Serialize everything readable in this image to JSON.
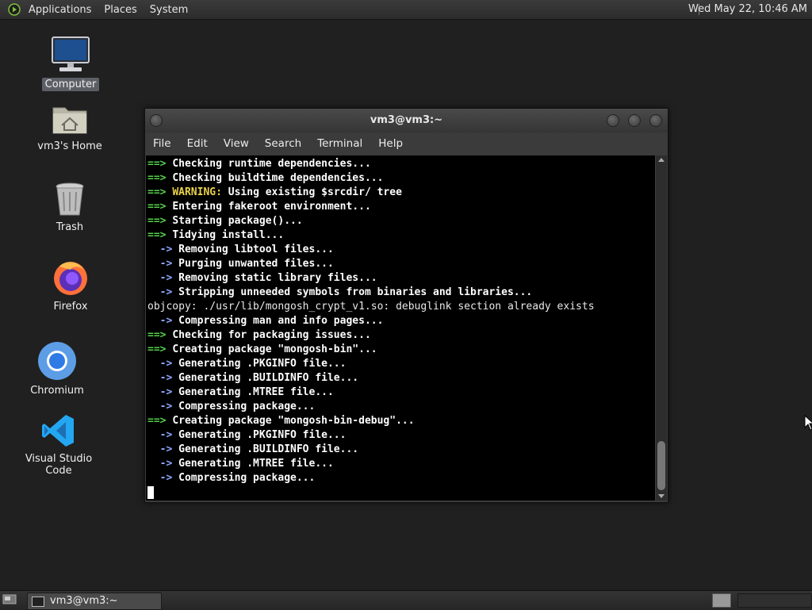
{
  "top_panel": {
    "menus": [
      "Applications",
      "Places",
      "System"
    ],
    "clock": "Wed May 22, 10:46 AM"
  },
  "desktop": {
    "icons": [
      {
        "label": "Computer",
        "icon": "computer-icon",
        "selected": true
      },
      {
        "label": "vm3's Home",
        "icon": "home-folder-icon",
        "selected": false
      },
      {
        "label": "Trash",
        "icon": "trash-icon",
        "selected": false
      },
      {
        "label": "Firefox",
        "icon": "firefox-icon",
        "selected": false
      },
      {
        "label": "Chromium",
        "icon": "chromium-icon",
        "selected": false
      },
      {
        "label": "Visual Studio Code",
        "icon": "vscode-icon",
        "selected": false
      }
    ]
  },
  "terminal": {
    "title": "vm3@vm3:~",
    "menu": [
      "File",
      "Edit",
      "View",
      "Search",
      "Terminal",
      "Help"
    ],
    "lines": [
      {
        "prefix": "==> ",
        "style": "arrow",
        "text": "Checking runtime dependencies..."
      },
      {
        "prefix": "==> ",
        "style": "arrow",
        "text": "Checking buildtime dependencies..."
      },
      {
        "prefix": "==> ",
        "style": "arrow",
        "warn": "WARNING:",
        "text": " Using existing $srcdir/ tree"
      },
      {
        "prefix": "==> ",
        "style": "arrow",
        "text": "Entering fakeroot environment..."
      },
      {
        "prefix": "==> ",
        "style": "arrow",
        "text": "Starting package()..."
      },
      {
        "prefix": "==> ",
        "style": "arrow",
        "text": "Tidying install..."
      },
      {
        "prefix": "  -> ",
        "style": "sub",
        "text": "Removing libtool files..."
      },
      {
        "prefix": "  -> ",
        "style": "sub",
        "text": "Purging unwanted files..."
      },
      {
        "prefix": "  -> ",
        "style": "sub",
        "text": "Removing static library files..."
      },
      {
        "prefix": "  -> ",
        "style": "sub",
        "text": "Stripping unneeded symbols from binaries and libraries..."
      },
      {
        "prefix": "",
        "style": "plain",
        "text": "objcopy: ./usr/lib/mongosh_crypt_v1.so: debuglink section already exists"
      },
      {
        "prefix": "  -> ",
        "style": "sub",
        "text": "Compressing man and info pages..."
      },
      {
        "prefix": "==> ",
        "style": "arrow",
        "text": "Checking for packaging issues..."
      },
      {
        "prefix": "==> ",
        "style": "arrow",
        "text": "Creating package \"mongosh-bin\"..."
      },
      {
        "prefix": "  -> ",
        "style": "sub",
        "text": "Generating .PKGINFO file..."
      },
      {
        "prefix": "  -> ",
        "style": "sub",
        "text": "Generating .BUILDINFO file..."
      },
      {
        "prefix": "  -> ",
        "style": "sub",
        "text": "Generating .MTREE file..."
      },
      {
        "prefix": "  -> ",
        "style": "sub",
        "text": "Compressing package..."
      },
      {
        "prefix": "==> ",
        "style": "arrow",
        "text": "Creating package \"mongosh-bin-debug\"..."
      },
      {
        "prefix": "  -> ",
        "style": "sub",
        "text": "Generating .PKGINFO file..."
      },
      {
        "prefix": "  -> ",
        "style": "sub",
        "text": "Generating .BUILDINFO file..."
      },
      {
        "prefix": "  -> ",
        "style": "sub",
        "text": "Generating .MTREE file..."
      },
      {
        "prefix": "  -> ",
        "style": "sub",
        "text": "Compressing package..."
      }
    ],
    "colors": {
      "arrow": "#55d24a",
      "warning": "#e9d24a",
      "sub": "#8ea8ff",
      "background": "#000000"
    }
  },
  "bottom_panel": {
    "task_label": "vm3@vm3:~"
  }
}
